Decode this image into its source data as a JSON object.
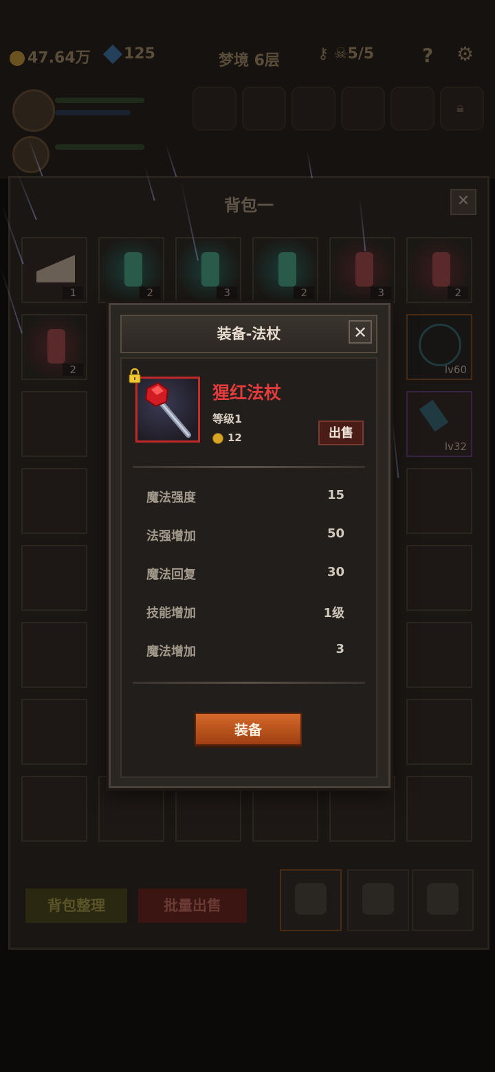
{
  "hud": {
    "gold": "47.64万",
    "gems": "125",
    "stage": "梦境 6层",
    "keys": "5/5",
    "help": "?"
  },
  "backpack": {
    "title": "背包一",
    "close": "✕",
    "row1_counts": [
      "1",
      "2",
      "3",
      "2",
      "3",
      "2"
    ],
    "row2_counts": [
      "2"
    ],
    "row2_level": "lv60",
    "row3_level": "lv32",
    "sort_button": "背包整理",
    "batch_sell_button": "批量出售"
  },
  "modal": {
    "title": "装备-法杖",
    "close": "✕",
    "item": {
      "name": "猩红法杖",
      "level_text": "等级1",
      "price": "12",
      "sell_button": "出售"
    },
    "stats": [
      {
        "label": "魔法强度",
        "value": "15"
      },
      {
        "label": "法强增加",
        "value": "50"
      },
      {
        "label": "魔法回复",
        "value": "30"
      },
      {
        "label": "技能增加",
        "value": "1级"
      },
      {
        "label": "魔法增加",
        "value": "3"
      }
    ],
    "equip_button": "装备"
  },
  "colors": {
    "item_name": "#e23c3c",
    "rarity_frame": "#c22a2a",
    "equip_button": "#c85a22"
  }
}
